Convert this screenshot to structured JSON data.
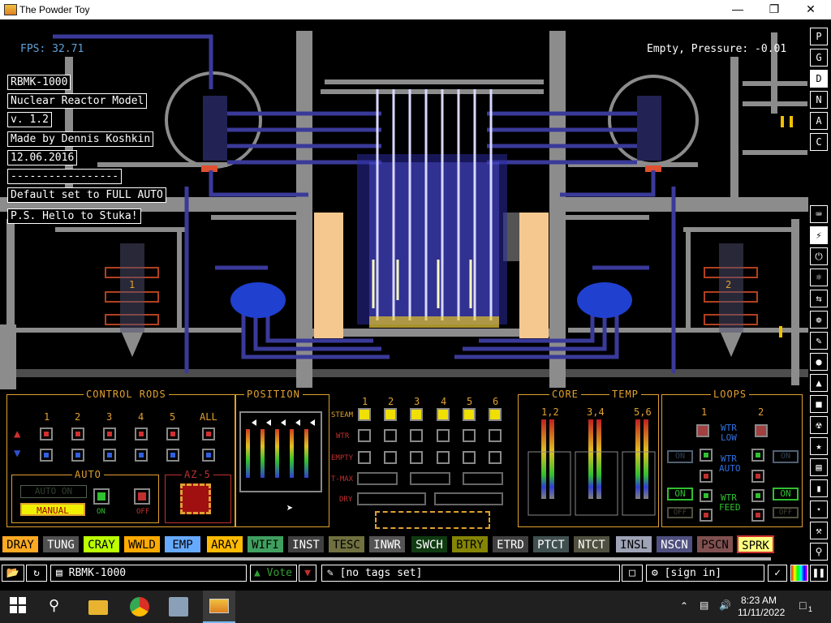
{
  "window": {
    "title": "The Powder Toy",
    "controls": {
      "minimize": "—",
      "maximize": "❐",
      "close": "✕"
    }
  },
  "hud": {
    "fps": "FPS: 32.71",
    "pressure": "Empty, Pressure: -0.01"
  },
  "signs": [
    "RBMK-1000",
    "Nuclear Reactor Model",
    "v. 1.2",
    "Made by Dennis Koshkin",
    "12.06.2016",
    "-----------------",
    "Default set to FULL AUTO",
    "P.S. Hello to Stuka!"
  ],
  "sim_labels": {
    "loop1": "1",
    "loop2": "2"
  },
  "right_menu": {
    "top": [
      "P",
      "G",
      "D",
      "N",
      "A",
      "C"
    ],
    "top_selected": "D",
    "icons": [
      "keyboard-icon",
      "plug-icon",
      "power-icon",
      "explosive-icon",
      "arrows-icon",
      "spray-icon",
      "pen-icon",
      "drop-icon",
      "fire-icon",
      "box-icon",
      "radiation-icon",
      "star-icon",
      "frame-icon",
      "bookmark-icon",
      "eraser-icon",
      "search-icon"
    ],
    "selected_icon": "plug-icon"
  },
  "panels": {
    "control_rods": {
      "title": "CONTROL RODS",
      "columns": [
        "1",
        "2",
        "3",
        "4",
        "5",
        "ALL"
      ],
      "auto_title": "AUTO",
      "auto_on_label": "AUTO ON",
      "manual_label": "MANUAL",
      "on_label": "ON",
      "off_label": "OFF",
      "az5_title": "AZ-5"
    },
    "position": {
      "title": "POSITION"
    },
    "steam": {
      "columns": [
        "1",
        "2",
        "3",
        "4",
        "5",
        "6"
      ],
      "rows": [
        "STEAM",
        "WTR",
        "EMPTY",
        "T-MAX",
        "DRY"
      ]
    },
    "core_temp": {
      "title_core": "CORE",
      "title_temp": "TEMP",
      "columns": [
        "1,2",
        "3,4",
        "5,6"
      ]
    },
    "loops": {
      "title": "LOOPS",
      "columns": [
        "1",
        "2"
      ],
      "wtr_low": [
        "WTR",
        "LOW"
      ],
      "wtr_auto": [
        "WTR",
        "AUTO"
      ],
      "wtr_feed": [
        "WTR",
        "FEED"
      ],
      "on_label": "ON",
      "off_label": "OFF"
    }
  },
  "elements": [
    {
      "name": "DRAY",
      "bg": "#ffaa22",
      "fg": "#000"
    },
    {
      "name": "TUNG",
      "bg": "#505050",
      "fg": "#fff"
    },
    {
      "name": "CRAY",
      "bg": "#bbff00",
      "fg": "#000"
    },
    {
      "name": "WWLD",
      "bg": "#ffaa00",
      "fg": "#000"
    },
    {
      "name": "EMP",
      "bg": "#66aaff",
      "fg": "#000"
    },
    {
      "name": "ARAY",
      "bg": "#ffbb00",
      "fg": "#000"
    },
    {
      "name": "WIFI",
      "bg": "#40a060",
      "fg": "#000"
    },
    {
      "name": "INST",
      "bg": "#404040",
      "fg": "#fff"
    },
    {
      "name": "TESC",
      "bg": "#707040",
      "fg": "#000"
    },
    {
      "name": "INWR",
      "bg": "#545454",
      "fg": "#fff"
    },
    {
      "name": "SWCH",
      "bg": "#103b11",
      "fg": "#fff"
    },
    {
      "name": "BTRY",
      "bg": "#858505",
      "fg": "#000"
    },
    {
      "name": "ETRD",
      "bg": "#404040",
      "fg": "#fff"
    },
    {
      "name": "PTCT",
      "bg": "#405050",
      "fg": "#fff"
    },
    {
      "name": "NTCT",
      "bg": "#505040",
      "fg": "#fff"
    },
    {
      "name": "INSL",
      "bg": "#9ea3b6",
      "fg": "#000"
    },
    {
      "name": "NSCN",
      "bg": "#505080",
      "fg": "#fff"
    },
    {
      "name": "PSCN",
      "bg": "#805050",
      "fg": "#000"
    },
    {
      "name": "SPRK",
      "bg": "#ffff80",
      "fg": "#000",
      "selected": true
    }
  ],
  "statusbar": {
    "save_name": "RBMK-1000",
    "vote": "Vote",
    "tags": "[no tags set]",
    "sign_in": "[sign in]"
  },
  "taskbar": {
    "time": "8:23 AM",
    "date": "11/11/2022",
    "notifications": "1"
  },
  "colors": {
    "panel_border": "#e0a030",
    "accent_blue": "#5fa0d8",
    "pipe_grey": "#8c8c8c",
    "pipe_blue": "#3a3a9a",
    "sand": "#f5c890"
  }
}
